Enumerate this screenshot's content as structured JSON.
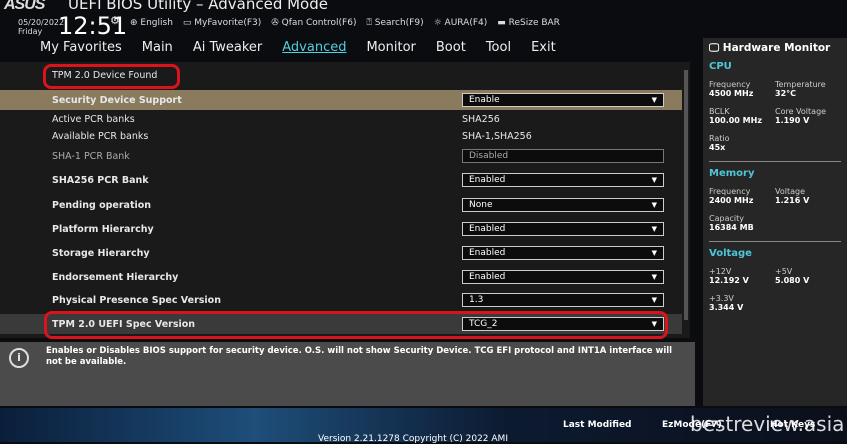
{
  "header": {
    "logo": "ASUS",
    "title": "UEFI BIOS Utility – Advanced Mode",
    "date": "05/20/2022",
    "day": "Friday",
    "time": "12:51",
    "tools": [
      "English",
      "MyFavorite(F3)",
      "Qfan Control(F6)",
      "Search(F9)",
      "AURA(F4)",
      "ReSize BAR"
    ]
  },
  "tabs": [
    {
      "label": "My Favorites"
    },
    {
      "label": "Main"
    },
    {
      "label": "Ai Tweaker"
    },
    {
      "label": "Advanced",
      "active": true
    },
    {
      "label": "Monitor"
    },
    {
      "label": "Boot"
    },
    {
      "label": "Tool"
    },
    {
      "label": "Exit"
    }
  ],
  "main": {
    "heading": "TPM 2.0 Device Found",
    "rows": [
      {
        "label": "Security Device Support",
        "value": "Enable",
        "type": "dropdown"
      },
      {
        "label": "Active PCR banks",
        "value": "SHA256",
        "type": "text"
      },
      {
        "label": "Available PCR banks",
        "value": "SHA-1,SHA256",
        "type": "text"
      },
      {
        "label": "SHA-1 PCR Bank",
        "value": "Disabled",
        "type": "disabled"
      },
      {
        "label": "SHA256 PCR Bank",
        "value": "Enabled",
        "type": "dropdown"
      },
      {
        "label": "Pending operation",
        "value": "None",
        "type": "dropdown"
      },
      {
        "label": "Platform Hierarchy",
        "value": "Enabled",
        "type": "dropdown"
      },
      {
        "label": "Storage Hierarchy",
        "value": "Enabled",
        "type": "dropdown"
      },
      {
        "label": "Endorsement Hierarchy",
        "value": "Enabled",
        "type": "dropdown"
      },
      {
        "label": "Physical Presence Spec Version",
        "value": "1.3",
        "type": "dropdown"
      },
      {
        "label": "TPM 2.0 UEFI Spec Version",
        "value": "TCG_2",
        "type": "dropdown"
      }
    ]
  },
  "help": "Enables or Disables BIOS support for security device. O.S. will not show Security Device. TCG EFI protocol and INT1A interface will not be available.",
  "hw": {
    "title": "Hardware Monitor",
    "cpu": "CPU",
    "cpu_freq_l": "Frequency",
    "cpu_freq": "4500 MHz",
    "temp_l": "Temperature",
    "temp": "32°C",
    "bclk_l": "BCLK",
    "bclk": "100.00 MHz",
    "cv_l": "Core Voltage",
    "cv": "1.190 V",
    "ratio_l": "Ratio",
    "ratio": "45x",
    "mem": "Memory",
    "mem_freq_l": "Frequency",
    "mem_freq": "2400 MHz",
    "mv_l": "Voltage",
    "mv": "1.216 V",
    "cap_l": "Capacity",
    "cap": "16384 MB",
    "volt": "Voltage",
    "v12_l": "+12V",
    "v12": "12.192 V",
    "v5_l": "+5V",
    "v5": "5.080 V",
    "v33_l": "+3.3V",
    "v33": "3.344 V"
  },
  "footer": {
    "last_modified": "Last Modified",
    "ezmode": "EzMode(F7)",
    "hotkeys": "Hot Keys",
    "version": "Version 2.21.1278 Copyright (C) 2022 AMI",
    "watermark": "bestreview.asia"
  }
}
